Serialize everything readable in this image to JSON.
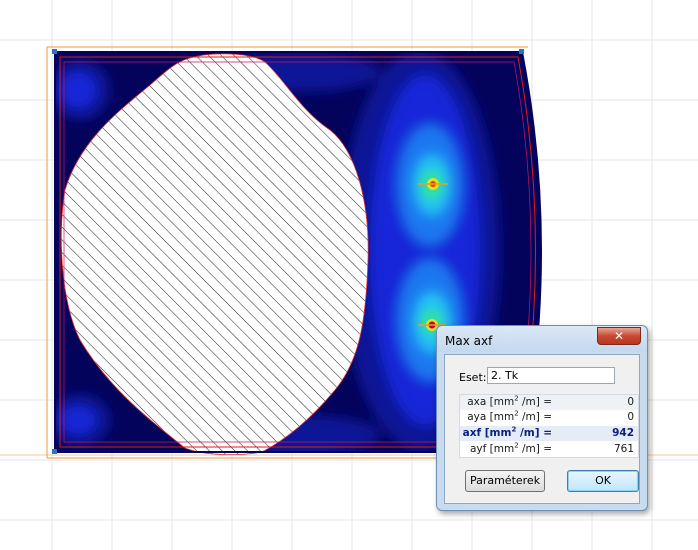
{
  "dialog": {
    "title": "Max axf",
    "close_label": "✕",
    "case_label": "Eset:",
    "case_value": "2. Tk",
    "rows": [
      {
        "pre": "axa [mm",
        "sup": "2",
        "post": " /m] =",
        "value": "0"
      },
      {
        "pre": "aya [mm",
        "sup": "2",
        "post": " /m] =",
        "value": "0"
      },
      {
        "pre": "axf [mm",
        "sup": "2",
        "post": " /m] =",
        "value": "942"
      },
      {
        "pre": "ayf [mm",
        "sup": "2",
        "post": " /m] =",
        "value": "761"
      }
    ],
    "params_button": "Paraméterek",
    "ok_button": "OK"
  },
  "colors": {
    "background_grid": "#ececec",
    "plate_base": "#03035c",
    "plate_level1": "#0a1296",
    "plate_level2": "#1228d8",
    "plate_level3": "#1b78f0",
    "plate_level4": "#20c4f4",
    "plate_level5": "#35e870",
    "plate_peak": "#e0e020",
    "outline_red": "#e01a1a",
    "outline_orange": "#e89a40"
  }
}
